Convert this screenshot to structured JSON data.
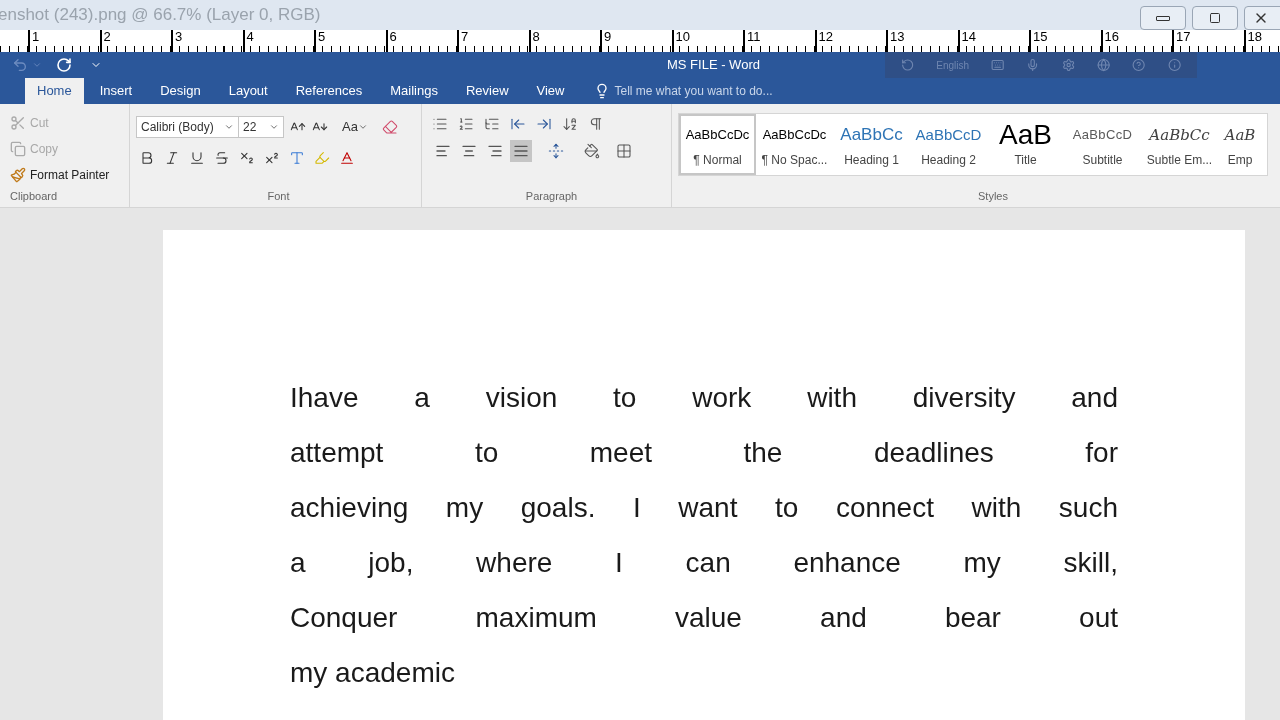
{
  "app_title": "enshot (243).png @ 66.7% (Layer 0, RGB)",
  "ruler": [
    "1",
    "2",
    "3",
    "4",
    "5",
    "6",
    "7",
    "8",
    "9",
    "10",
    "11",
    "12",
    "13",
    "14",
    "15",
    "16",
    "17",
    "18"
  ],
  "word_title": "MS FILE - Word",
  "language_bar": {
    "language": "English"
  },
  "tabs": [
    {
      "label": "Home",
      "selected": true
    },
    {
      "label": "Insert",
      "selected": false
    },
    {
      "label": "Design",
      "selected": false
    },
    {
      "label": "Layout",
      "selected": false
    },
    {
      "label": "References",
      "selected": false
    },
    {
      "label": "Mailings",
      "selected": false
    },
    {
      "label": "Review",
      "selected": false
    },
    {
      "label": "View",
      "selected": false
    }
  ],
  "tell_me": {
    "placeholder": "Tell me what you want to do..."
  },
  "clipboard": {
    "label": "Clipboard",
    "items": [
      {
        "label": "Cut",
        "kind": "cut",
        "disabled": true
      },
      {
        "label": "Copy",
        "kind": "copy",
        "disabled": true
      },
      {
        "label": "Format Painter",
        "kind": "painter",
        "disabled": false
      }
    ]
  },
  "font": {
    "label": "Font",
    "name": "Calibri (Body)",
    "size": "22",
    "change_case": "Aa"
  },
  "paragraph": {
    "label": "Paragraph",
    "alignment": [
      {
        "kind": "left",
        "selected": false
      },
      {
        "kind": "center",
        "selected": false
      },
      {
        "kind": "right",
        "selected": false
      },
      {
        "kind": "justify",
        "selected": true
      }
    ]
  },
  "styles": {
    "label": "Styles",
    "items": [
      {
        "preview": "AaBbCcDc",
        "name": "¶ Normal",
        "kind": "normal",
        "selected": true
      },
      {
        "preview": "AaBbCcDc",
        "name": "¶ No Spac...",
        "kind": "normal",
        "selected": false
      },
      {
        "preview": "AaBbCc",
        "name": "Heading 1",
        "kind": "heading1",
        "selected": false
      },
      {
        "preview": "AaBbCcD",
        "name": "Heading 2",
        "kind": "heading2",
        "selected": false
      },
      {
        "preview": "AaB",
        "name": "Title",
        "kind": "title",
        "selected": false
      },
      {
        "preview": "AaBbCcD",
        "name": "Subtitle",
        "kind": "subtitle",
        "selected": false
      },
      {
        "preview": "AaBbCc",
        "name": "Subtle Em...",
        "kind": "emphasis",
        "selected": false
      },
      {
        "preview": "AaB",
        "name": "Emp",
        "kind": "emphasis",
        "selected": false
      }
    ]
  },
  "document": {
    "lines": [
      "Ihave a vision to work with diversity and",
      "attempt to meet the deadlines for",
      "achieving my goals. I want to connect with such",
      "a job, where I can enhance my skill,",
      "Conquer maximum value and bear out",
      "my academic"
    ]
  }
}
